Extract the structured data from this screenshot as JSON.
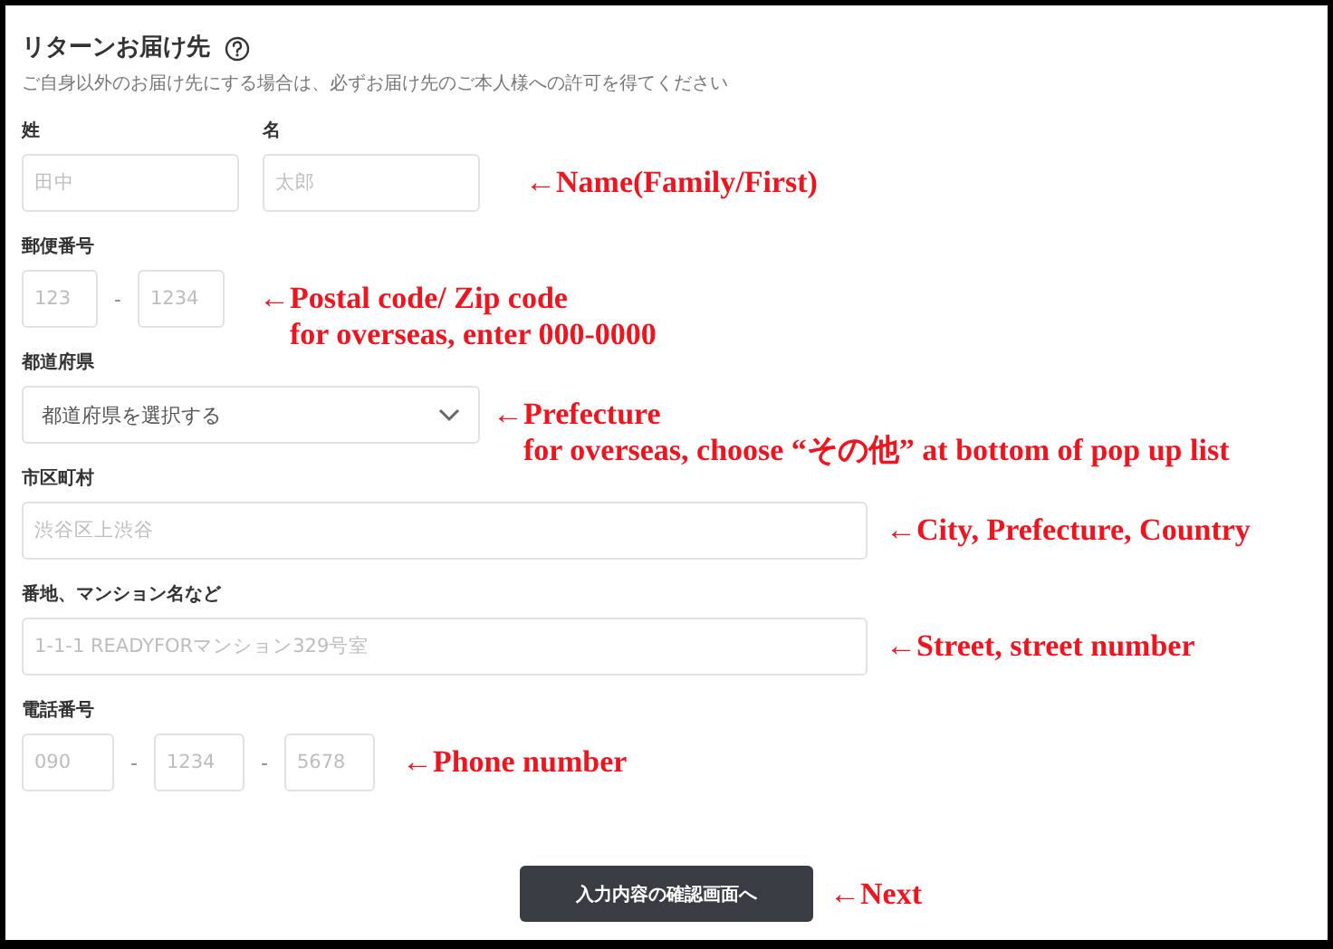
{
  "header": {
    "title": "リターンお届け先",
    "note": "ご自身以外のお届け先にする場合は、必ずお届け先のご本人様への許可を得てください"
  },
  "fields": [
    {
      "kind": "name",
      "columns": [
        {
          "label": "姓",
          "placeholder": "田中"
        },
        {
          "label": "名",
          "placeholder": "太郎"
        }
      ],
      "annotation": [
        "←Name(Family/First)"
      ]
    },
    {
      "kind": "postal",
      "label": "郵便番号",
      "placeholders": [
        "123",
        "1234"
      ],
      "separators": [
        "-"
      ],
      "annotation": [
        "←Postal code/ Zip code",
        "for overseas, enter 000-0000"
      ]
    },
    {
      "kind": "select",
      "label": "都道府県",
      "value": "都道府県を選択する",
      "annotation": [
        "←Prefecture",
        "for overseas, choose “その他” at bottom of pop up list"
      ]
    },
    {
      "kind": "text",
      "label": "市区町村",
      "placeholder": "渋谷区上渋谷",
      "annotation": [
        "←City, Prefecture, Country"
      ]
    },
    {
      "kind": "text",
      "label": "番地、マンション名など",
      "placeholder": "1-1-1 READYFORマンション329号室",
      "annotation": [
        "←Street, street number"
      ]
    },
    {
      "kind": "phone",
      "label": "電話番号",
      "placeholders": [
        "090",
        "1234",
        "5678"
      ],
      "separators": [
        "-",
        "-"
      ],
      "annotation": [
        "←Phone number"
      ]
    }
  ],
  "submit": {
    "label": "入力内容の確認画面へ",
    "annotation": "←Next"
  }
}
